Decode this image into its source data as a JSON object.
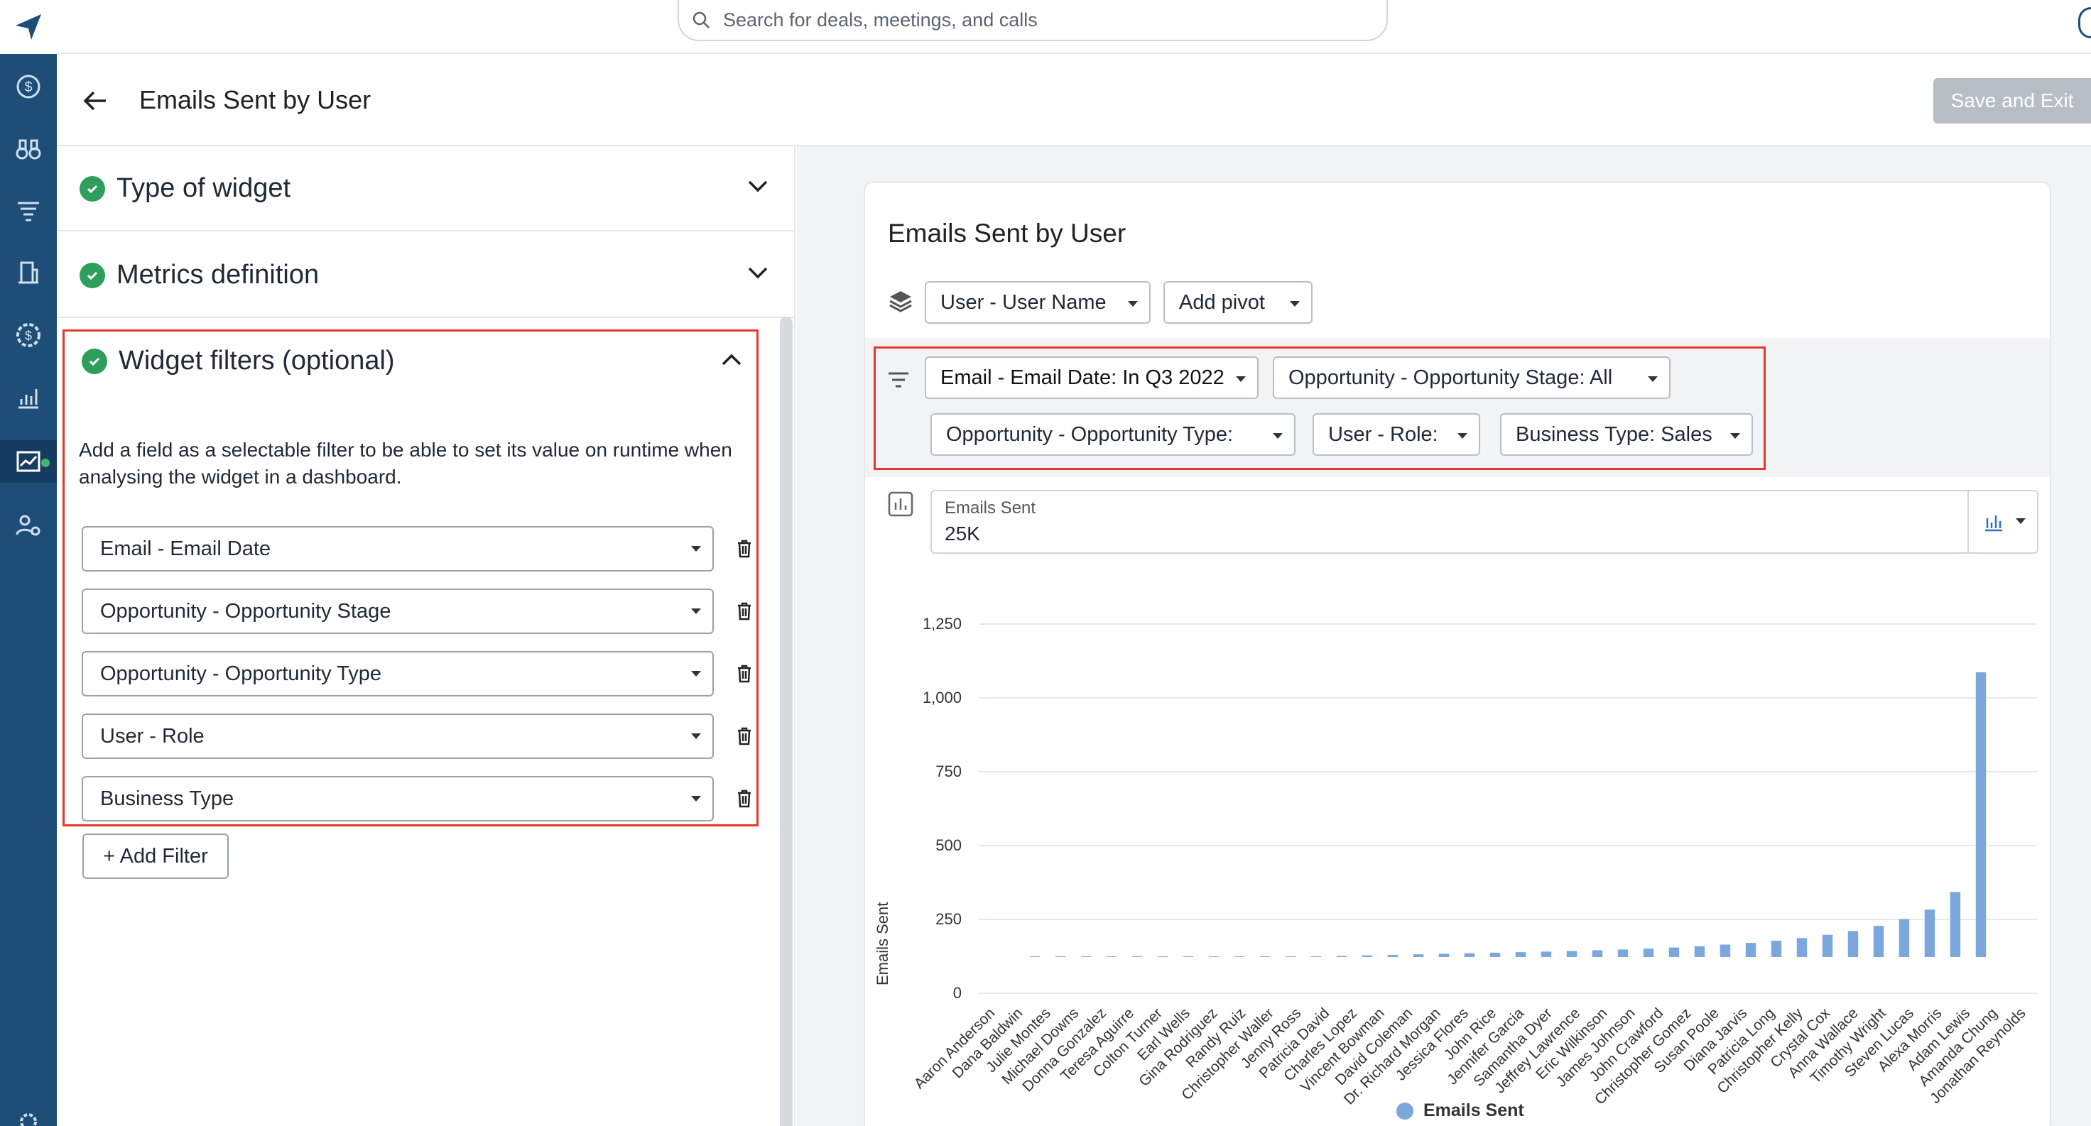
{
  "search": {
    "placeholder": "Search for deals, meetings, and calls"
  },
  "header": {
    "title": "Emails Sent by User",
    "save_label": "Save and Exit"
  },
  "sidebar": {
    "icons": [
      "logo-icon",
      "dollar-icon",
      "binoculars-icon",
      "funnel-icon",
      "building-icon",
      "gear-dollar-icon",
      "chart-icon",
      "dashboard-icon",
      "user-gear-icon",
      "settings-icon"
    ]
  },
  "config": {
    "sections": [
      {
        "label": "Type of widget"
      },
      {
        "label": "Metrics definition"
      }
    ],
    "filters_section": {
      "label": "Widget filters (optional)",
      "description": "Add a field as a selectable filter to be able to set its value on runtime when analysing the widget in a dashboard.",
      "filters": [
        {
          "value": "Email - Email Date"
        },
        {
          "value": "Opportunity - Opportunity Stage"
        },
        {
          "value": "Opportunity - Opportunity Type"
        },
        {
          "value": "User - Role"
        },
        {
          "value": "Business Type"
        }
      ],
      "add_label": "+ Add Filter"
    }
  },
  "preview": {
    "title": "Emails Sent by User",
    "group_by": "User - User Name",
    "add_pivot": "Add pivot",
    "runtime_filters": [
      {
        "label": "Email - Email Date: In Q3 2022"
      },
      {
        "label": "Opportunity - Opportunity Stage: All"
      },
      {
        "label": "Opportunity - Opportunity Type:"
      },
      {
        "label": "User - Role:"
      },
      {
        "label": "Business Type: Sales"
      }
    ],
    "measure": {
      "label": "Emails Sent",
      "value": "25K"
    }
  },
  "chart_data": {
    "type": "bar",
    "ylabel": "Emails Sent",
    "ylim": [
      0,
      1250
    ],
    "yticks": [
      "1,250",
      "1,000",
      "750",
      "500",
      "250",
      "0"
    ],
    "bar_color": "#7ba7dc",
    "legend": [
      {
        "name": "Emails Sent"
      }
    ],
    "legend_position": "bottom",
    "categories": [
      "Aaron Anderson",
      "Dana Baldwin",
      "Julie Montes",
      "Michael Downs",
      "Donna Gonzalez",
      "Teresa Aguirre",
      "Colton Turner",
      "Earl Wells",
      "Gina Rodriguez",
      "Randy Ruiz",
      "Christopher Waller",
      "Jenny Ross",
      "Patricia David",
      "Charles Lopez",
      "Vincent Bowman",
      "David Coleman",
      "Dr. Richard Morgan",
      "Jessica Flores",
      "John Rice",
      "Jennifer Garcia",
      "Samantha Dyer",
      "Jeffrey Lawrence",
      "Eric Wilkinson",
      "James Johnson",
      "John Crawford",
      "Christopher Gomez",
      "Susan Poole",
      "Diana Jarvis",
      "Patricia Long",
      "Christopher Kelly",
      "Crystal Cox",
      "Anna Wallace",
      "Timothy Wright",
      "Steven Lucas",
      "Alexa Morris",
      "Adam Lewis",
      "Amanda Chung",
      "Jonathan Reynolds"
    ],
    "values": [
      0,
      0,
      0,
      0,
      0,
      0,
      0,
      0,
      0,
      0,
      0,
      2,
      4,
      6,
      8,
      10,
      12,
      14,
      16,
      18,
      20,
      22,
      25,
      28,
      31,
      35,
      40,
      46,
      52,
      60,
      70,
      82,
      96,
      115,
      140,
      175,
      240,
      1050
    ]
  }
}
